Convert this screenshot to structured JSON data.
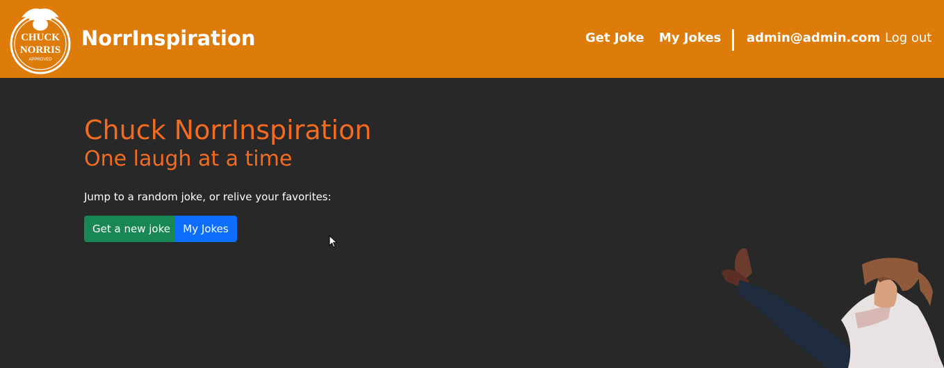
{
  "brand": {
    "name": "NorrInspiration",
    "logo_text_top": "CHUCK",
    "logo_text_bottom": "NORRIS",
    "logo_text_small": "APPROVED"
  },
  "nav": {
    "get_joke": "Get Joke",
    "my_jokes": "My Jokes",
    "user_email": "admin@admin.com",
    "logout": "Log out"
  },
  "hero": {
    "title": "Chuck NorrInspiration",
    "subtitle": "One laugh at a time",
    "lead": "Jump to a random joke, or relive your favorites:",
    "btn_new_joke": "Get a new joke",
    "btn_my_jokes": "My Jokes"
  },
  "colors": {
    "navbar": "#de7c0b",
    "background": "#282828",
    "heading": "#f26b21",
    "btn_success": "#198754",
    "btn_primary": "#0d6efd"
  }
}
